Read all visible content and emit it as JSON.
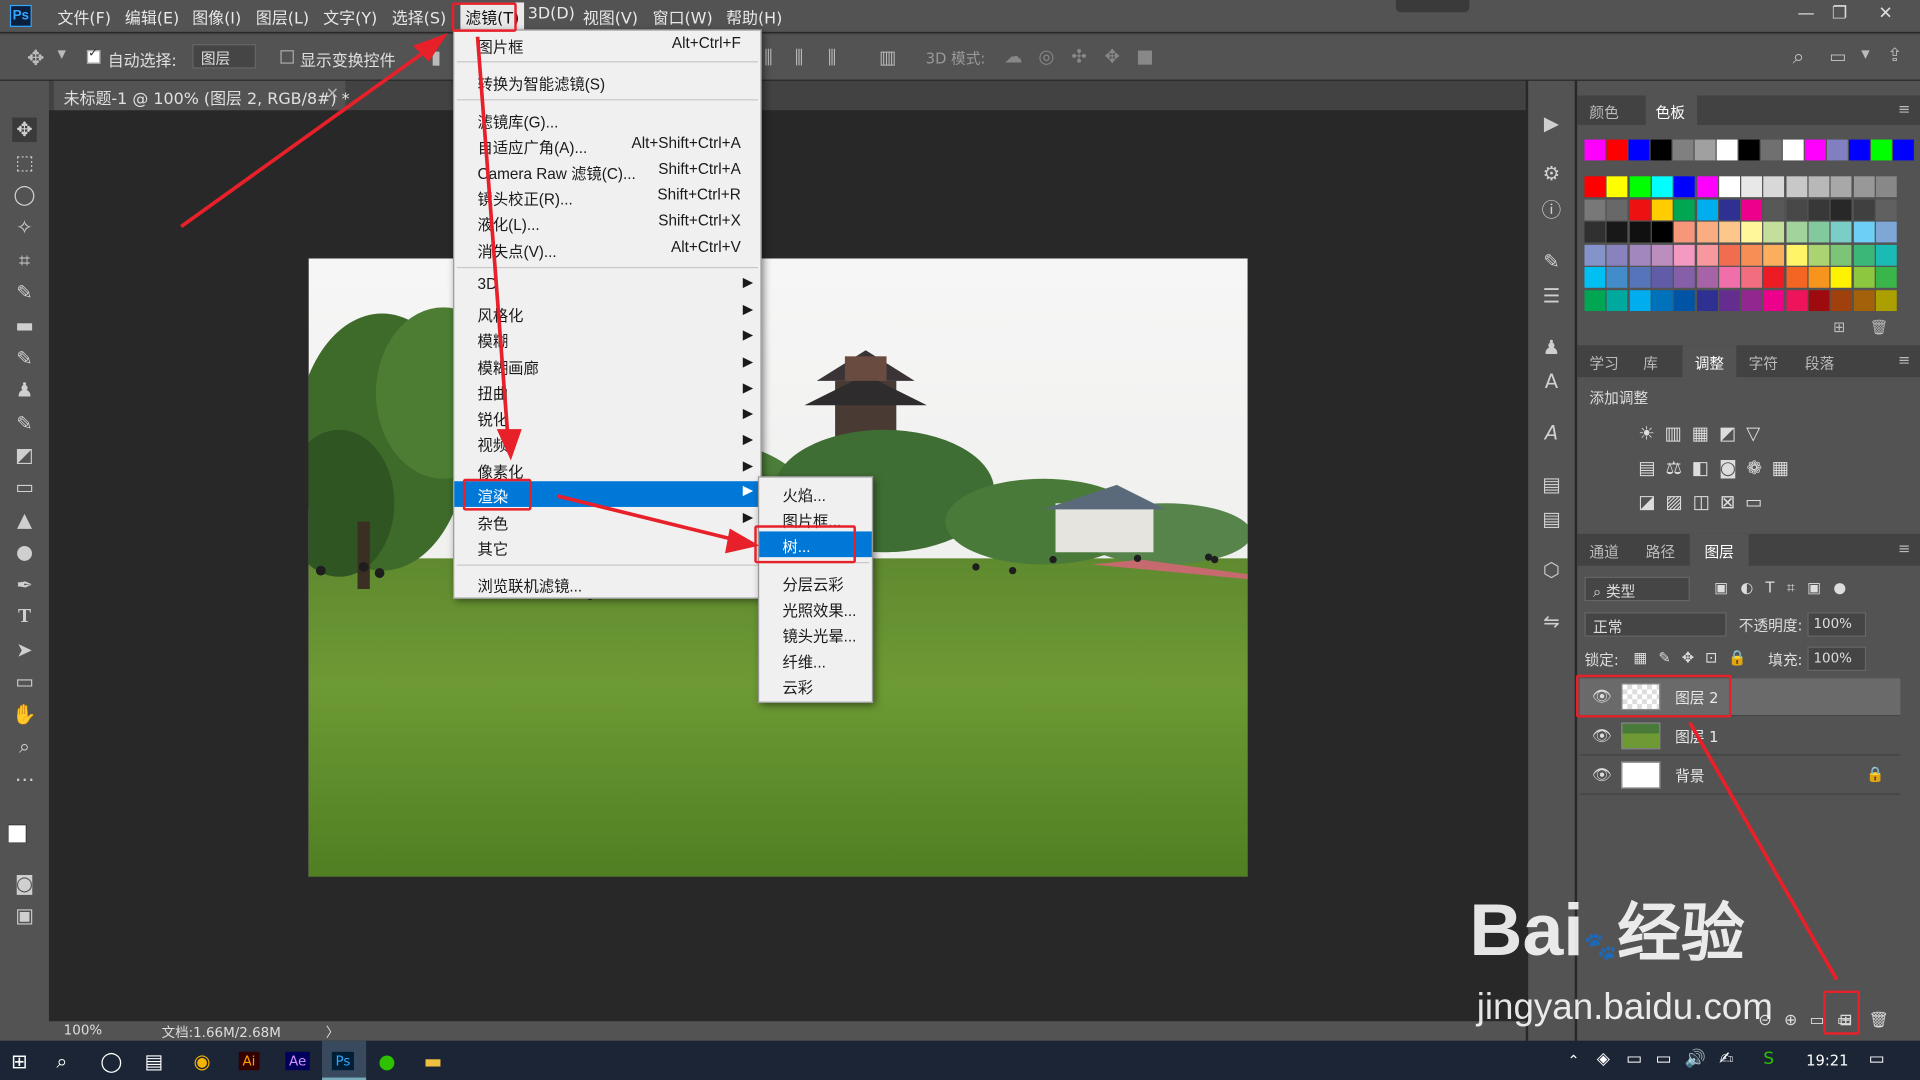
{
  "app": {
    "logo": "Ps",
    "window_controls": [
      "—",
      "❐",
      "✕"
    ]
  },
  "menubar": {
    "items": [
      "文件(F)",
      "编辑(E)",
      "图像(I)",
      "图层(L)",
      "文字(Y)",
      "选择(S)",
      "滤镜(T)",
      "3D(D)",
      "视图(V)",
      "窗口(W)",
      "帮助(H)"
    ]
  },
  "options": {
    "auto_select_label": "自动选择:",
    "auto_select_value": "图层",
    "show_transform_label": "显示变换控件",
    "mode_3d_label": "3D 模式:"
  },
  "document": {
    "tab_title": "未标题-1 @ 100% (图层 2, RGB/8#) *",
    "tab_close": "×"
  },
  "filter_menu": {
    "items": [
      {
        "label": "图片框",
        "shortcut": "Alt+Ctrl+F"
      },
      {
        "label": "转换为智能滤镜(S)",
        "shortcut": ""
      },
      {
        "label": "滤镜库(G)...",
        "shortcut": ""
      },
      {
        "label": "自适应广角(A)...",
        "shortcut": "Alt+Shift+Ctrl+A"
      },
      {
        "label": "Camera Raw 滤镜(C)...",
        "shortcut": "Shift+Ctrl+A"
      },
      {
        "label": "镜头校正(R)...",
        "shortcut": "Shift+Ctrl+R"
      },
      {
        "label": "液化(L)...",
        "shortcut": "Shift+Ctrl+X"
      },
      {
        "label": "消失点(V)...",
        "shortcut": "Alt+Ctrl+V"
      },
      {
        "label": "3D",
        "shortcut": ""
      },
      {
        "label": "风格化",
        "shortcut": ""
      },
      {
        "label": "模糊",
        "shortcut": ""
      },
      {
        "label": "模糊画廊",
        "shortcut": ""
      },
      {
        "label": "扭曲",
        "shortcut": ""
      },
      {
        "label": "锐化",
        "shortcut": ""
      },
      {
        "label": "视频",
        "shortcut": ""
      },
      {
        "label": "像素化",
        "shortcut": ""
      },
      {
        "label": "渲染",
        "shortcut": ""
      },
      {
        "label": "杂色",
        "shortcut": ""
      },
      {
        "label": "其它",
        "shortcut": ""
      },
      {
        "label": "浏览联机滤镜...",
        "shortcut": ""
      }
    ]
  },
  "render_submenu": {
    "items": [
      "火焰...",
      "图片框...",
      "树...",
      "分层云彩",
      "光照效果...",
      "镜头光晕...",
      "纤维...",
      "云彩"
    ]
  },
  "swatches_panel": {
    "tabs": [
      "颜色",
      "色板"
    ],
    "active": "色板"
  },
  "swatch_colors": {
    "recent": [
      "#ff00ff",
      "#ff0000",
      "#0000ff",
      "#000000",
      "#808080",
      "#a0a0a0",
      "#ffffff",
      "#000000",
      "#707070",
      "#ffffff",
      "#ff00ff",
      "#8080c0",
      "#0000ff",
      "#00ff00",
      "#0000ff"
    ],
    "grid": [
      [
        "#ff0000",
        "#ffff00",
        "#00ff00",
        "#00ffff",
        "#0000ff",
        "#ff00ff",
        "#ffffff",
        "#e8e8e8",
        "#d8d8d8",
        "#c8c8c8",
        "#b8b8b8",
        "#a8a8a8",
        "#989898",
        "#888888"
      ],
      [
        "#787878",
        "#686868",
        "#ee1111",
        "#ffcc00",
        "#00a651",
        "#00aeef",
        "#2e3192",
        "#ec008c",
        "#585858",
        "#484848",
        "#383838",
        "#282828",
        "#404040",
        "#606060"
      ],
      [
        "#303030",
        "#181818",
        "#101010",
        "#000000",
        "#f7977a",
        "#f9ad81",
        "#fdc68a",
        "#fff79a",
        "#c4df9b",
        "#a3d39c",
        "#82ca9d",
        "#7bcdc8",
        "#6ecff6",
        "#7ea7d8"
      ],
      [
        "#8493ca",
        "#8882be",
        "#a187be",
        "#bc8dbf",
        "#f49ac2",
        "#f6989d",
        "#f26c4f",
        "#f68e55",
        "#fbaf5c",
        "#fff467",
        "#acd372",
        "#7cc576",
        "#3bb878",
        "#1abbb4"
      ],
      [
        "#00bff3",
        "#438cca",
        "#5574b9",
        "#605ca8",
        "#855fa8",
        "#a763a8",
        "#f06ea9",
        "#f26d7d",
        "#ed1c24",
        "#f26522",
        "#f7941d",
        "#fff200",
        "#8dc73f",
        "#39b54a"
      ],
      [
        "#00a651",
        "#00a99d",
        "#00aeef",
        "#0072bc",
        "#0054a6",
        "#2e3192",
        "#662d91",
        "#92278f",
        "#ec008c",
        "#ed145b",
        "#9e0b0f",
        "#a0410d",
        "#a36209",
        "#aba000"
      ]
    ]
  },
  "adjust_panel": {
    "tabs": [
      "学习",
      "库",
      "调整",
      "字符",
      "段落"
    ],
    "active": "调整",
    "title": "添加调整"
  },
  "layers_panel": {
    "tabs": [
      "通道",
      "路径",
      "图层"
    ],
    "active": "图层",
    "filter_kind": "类型",
    "blend_mode": "正常",
    "opacity_label": "不透明度:",
    "opacity_value": "100%",
    "lock_label": "锁定:",
    "fill_label": "填充:",
    "fill_value": "100%",
    "layers": [
      {
        "name": "图层 2"
      },
      {
        "name": "图层 1"
      },
      {
        "name": "背景"
      }
    ]
  },
  "status": {
    "zoom": "100%",
    "doc_info": "文档:1.66M/2.68M",
    "arrow": "〉"
  },
  "taskbar": {
    "time": "19:21",
    "apps": [
      "Ai",
      "Ae",
      "Ps"
    ]
  },
  "watermark": {
    "brand": "Bai",
    "brand_cn": "经验",
    "url": "jingyan.baidu.com"
  },
  "accent_colors": {
    "highlight": "#0078d7",
    "annotation_red": "#e8202a"
  }
}
